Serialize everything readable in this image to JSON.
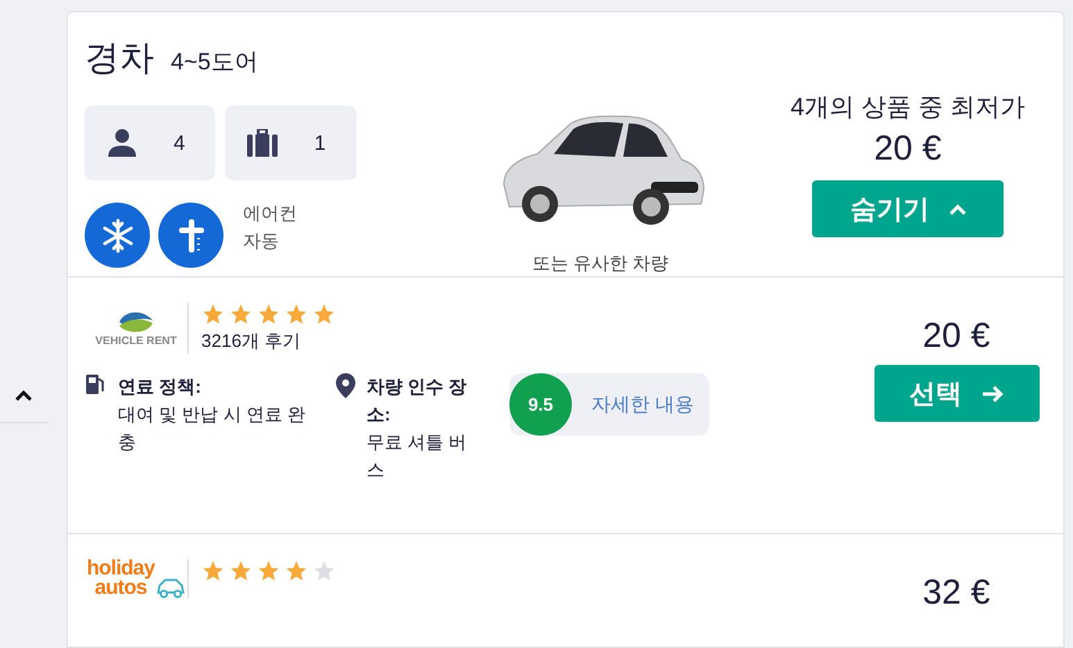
{
  "category": {
    "title": "경차",
    "doors": "4~5도어",
    "specs": [
      {
        "kind": "person",
        "value": "4"
      },
      {
        "kind": "bag",
        "value": "1"
      }
    ],
    "extras": [
      "에어컨",
      "자동"
    ],
    "image_caption": "또는 유사한 차량",
    "offer_count": "4개의 상품 중 최저가",
    "lowest_price": "20 €",
    "toggle_button": {
      "label": "숨기기",
      "expanded": true
    }
  },
  "offers": [
    {
      "logo": {
        "kind": "vehicle",
        "lines": [
          "VEHICLE RENT"
        ]
      },
      "stars": 5,
      "reviews": "3216개 후기",
      "fuel": {
        "label": "연료 정책:",
        "text": "대여 및 반납 시 연료 완충"
      },
      "pickup": {
        "label": "차량 인수 장소:",
        "text": "무료 셔틀 버스"
      },
      "score": "9.5",
      "details": "자세한 내용",
      "price": "20 €",
      "button": "선택"
    },
    {
      "logo": {
        "kind": "holiday",
        "lines": [
          "holiday",
          "autos"
        ]
      },
      "stars": 4,
      "price": "32 €"
    }
  ]
}
